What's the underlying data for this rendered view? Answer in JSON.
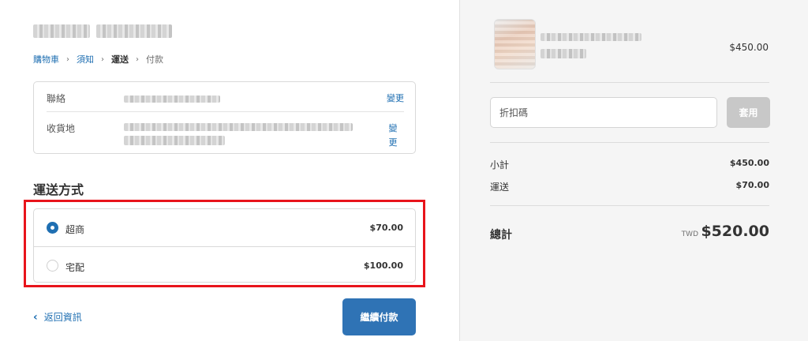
{
  "breadcrumb": {
    "items": [
      "購物車",
      "須知",
      "運送",
      "付款"
    ],
    "separator": "›"
  },
  "info": {
    "contact_label": "聯絡",
    "contact_change": "變更",
    "address_label": "收貨地",
    "address_change": "變更"
  },
  "shipping": {
    "title": "運送方式",
    "options": [
      {
        "name": "超商",
        "price": "$70.00",
        "selected": true
      },
      {
        "name": "宅配",
        "price": "$100.00",
        "selected": false
      }
    ]
  },
  "footer": {
    "return_label": "返回資訊",
    "return_icon": "chevron-left-icon",
    "continue_label": "繼續付款"
  },
  "summary": {
    "item_price": "$450.00",
    "discount_placeholder": "折扣碼",
    "apply_label": "套用",
    "subtotal_label": "小計",
    "subtotal_value": "$450.00",
    "shipping_label": "運送",
    "shipping_value": "$70.00",
    "total_label": "總計",
    "total_currency": "TWD",
    "total_value": "$520.00"
  },
  "colors": {
    "accent": "#1f6fb2",
    "button": "#2f73b5",
    "highlight": "#e8141b",
    "sidebar_bg": "#f5f5f5"
  }
}
